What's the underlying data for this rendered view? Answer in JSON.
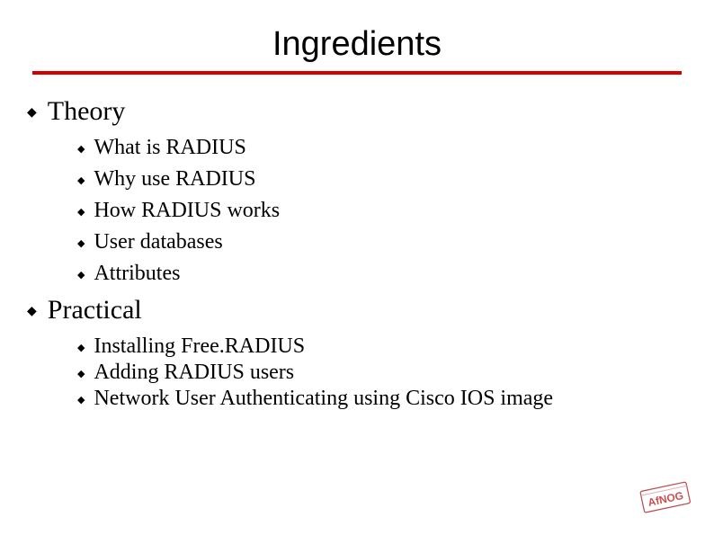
{
  "title": "Ingredients",
  "sections": [
    {
      "label": "Theory",
      "items": [
        "What is RADIUS",
        "Why use RADIUS",
        "How RADIUS works",
        "User databases",
        "Attributes"
      ]
    },
    {
      "label": "Practical",
      "items": [
        "Installing Free.RADIUS",
        "Adding RADIUS users",
        "Network User Authenticating using Cisco IOS image"
      ]
    }
  ],
  "logo_text_top": "AfNOG",
  "colors": {
    "rule": "#d40000",
    "logo_text": "#c94f4f",
    "logo_border": "#b94a4a"
  }
}
